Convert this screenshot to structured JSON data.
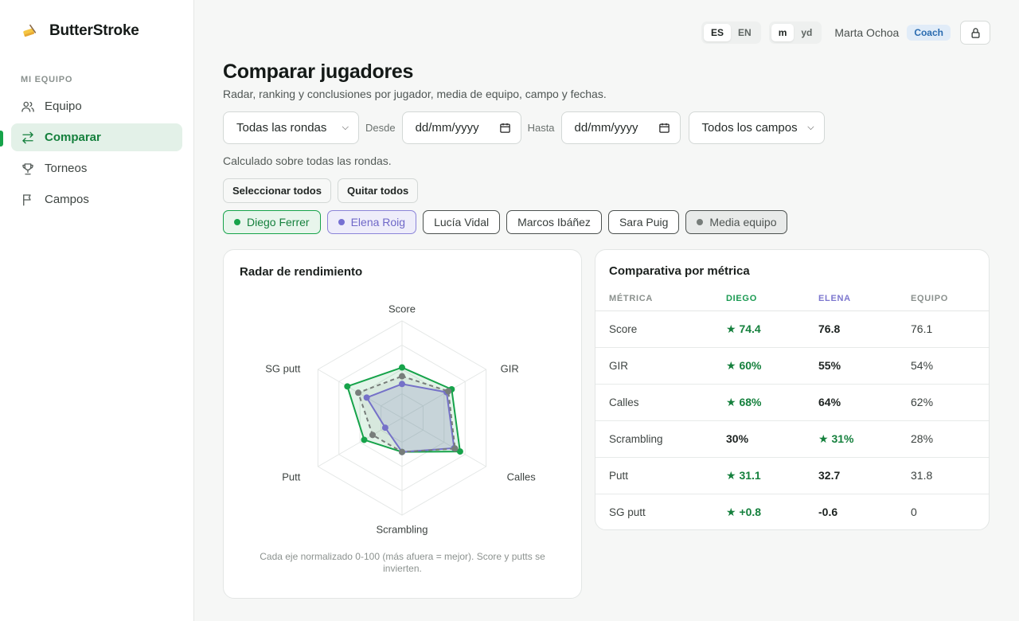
{
  "app": {
    "name": "ButterStroke"
  },
  "sidebar": {
    "section_label": "MI EQUIPO",
    "items": [
      {
        "label": "Equipo",
        "icon": "users-icon",
        "active": false
      },
      {
        "label": "Comparar",
        "icon": "arrows-icon",
        "active": true
      },
      {
        "label": "Torneos",
        "icon": "trophy-icon",
        "active": false
      },
      {
        "label": "Campos",
        "icon": "flag-icon",
        "active": false
      }
    ]
  },
  "topbar": {
    "lang": {
      "es": "ES",
      "en": "EN",
      "selected": "ES"
    },
    "units": {
      "m": "m",
      "yd": "yd",
      "selected": "m"
    },
    "user_name": "Marta Ochoa",
    "role": "Coach"
  },
  "page": {
    "title": "Comparar jugadores",
    "subtitle": "Radar, ranking y conclusiones por jugador, media de equipo, campo y fechas."
  },
  "filters": {
    "rounds": "Todas las rondas",
    "from_label": "Desde",
    "from_value": "dd/mm/yyyy",
    "to_label": "Hasta",
    "to_value": "dd/mm/yyyy",
    "course": "Todos los campos"
  },
  "calc_note": "Calculado sobre todas las rondas.",
  "selection": {
    "select_all": "Seleccionar todos",
    "clear_all": "Quitar todos"
  },
  "players": [
    {
      "name": "Diego Ferrer",
      "selected": true,
      "color": "#16a34a"
    },
    {
      "name": "Elena Roig",
      "selected": true,
      "color": "#7570d2"
    },
    {
      "name": "Lucía Vidal",
      "selected": false
    },
    {
      "name": "Marcos Ibáñez",
      "selected": false
    },
    {
      "name": "Sara Puig",
      "selected": false
    },
    {
      "name": "Media equipo",
      "selected": true,
      "color": "#777d7a"
    }
  ],
  "radar": {
    "title": "Radar de rendimiento",
    "axes": [
      "Score",
      "GIR",
      "Calles",
      "Scrambling",
      "Putt",
      "SG putt"
    ],
    "caption": "Cada eje normalizado 0-100 (más afuera = mejor). Score y putts se invierten."
  },
  "chart_data": {
    "type": "radar",
    "title": "Radar de rendimiento",
    "axes": [
      "Score",
      "GIR",
      "Calles",
      "Scrambling",
      "Putt",
      "SG putt"
    ],
    "range": [
      0,
      100
    ],
    "rings": 4,
    "series": [
      {
        "name": "Diego Ferrer",
        "color": "#16a34a",
        "values": [
          52,
          59,
          69,
          35,
          45,
          65
        ]
      },
      {
        "name": "Elena Roig",
        "color": "#7570d2",
        "values": [
          35,
          53,
          62,
          35,
          20,
          42
        ]
      },
      {
        "name": "Media equipo",
        "color": "#777d7a",
        "values": [
          43,
          55,
          63,
          35,
          35,
          52
        ]
      }
    ]
  },
  "comparison": {
    "title": "Comparativa por métrica",
    "headers": [
      "MÉTRICA",
      "DIEGO",
      "ELENA",
      "EQUIPO"
    ],
    "rows": [
      {
        "metric": "Score",
        "diego": "★ 74.4",
        "elena": "76.8",
        "team": "76.1",
        "best": "diego"
      },
      {
        "metric": "GIR",
        "diego": "★ 60%",
        "elena": "55%",
        "team": "54%",
        "best": "diego"
      },
      {
        "metric": "Calles",
        "diego": "★ 68%",
        "elena": "64%",
        "team": "62%",
        "best": "diego"
      },
      {
        "metric": "Scrambling",
        "diego": "30%",
        "elena": "★ 31%",
        "team": "28%",
        "best": "elena"
      },
      {
        "metric": "Putt",
        "diego": "★ 31.1",
        "elena": "32.7",
        "team": "31.8",
        "best": "diego"
      },
      {
        "metric": "SG putt",
        "diego": "★ +0.8",
        "elena": "-0.6",
        "team": "0",
        "best": "diego"
      }
    ]
  },
  "colors": {
    "accent": "#16a34a",
    "accent_bg": "#e3f1e8",
    "elena": "#7570d2",
    "team": "#777d7a"
  }
}
